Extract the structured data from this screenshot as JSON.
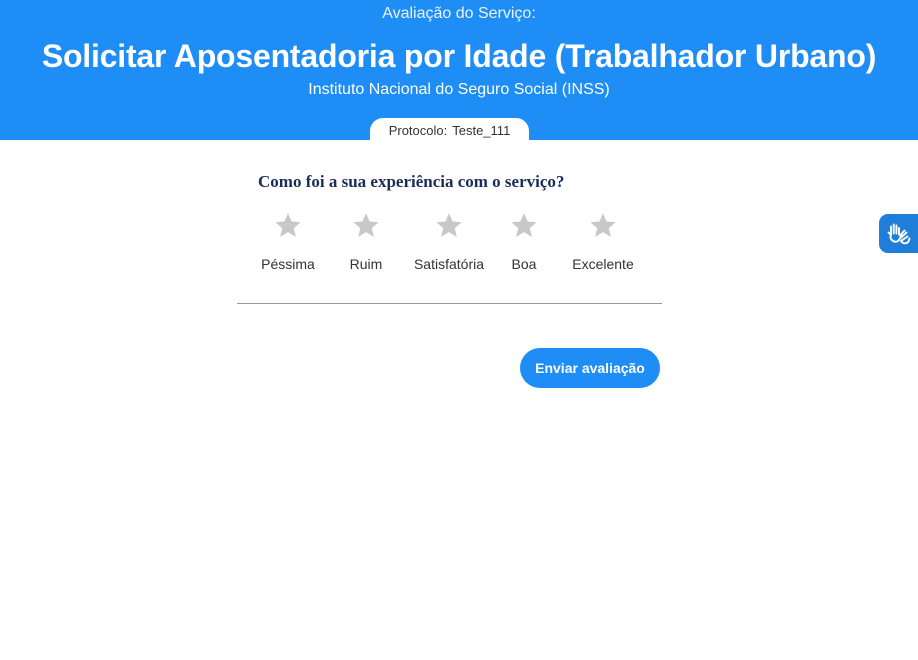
{
  "header": {
    "eyebrow": "Avaliação do Serviço:",
    "title": "Solicitar Aposentadoria por Idade (Trabalhador Urbano)",
    "subtitle": "Instituto Nacional do Seguro Social (INSS)",
    "protocol_label": "Protocolo:",
    "protocol_value": "Teste_111"
  },
  "survey": {
    "question": "Como foi a sua experiência com o serviço?",
    "options": [
      {
        "label": "Péssima",
        "icon": "star-icon"
      },
      {
        "label": "Ruim",
        "icon": "star-icon"
      },
      {
        "label": "Satisfatória",
        "icon": "star-icon"
      },
      {
        "label": "Boa",
        "icon": "star-icon"
      },
      {
        "label": "Excelente",
        "icon": "star-icon"
      }
    ],
    "submit_label": "Enviar avaliação"
  },
  "accessibility": {
    "icon": "sign-language-hands-icon"
  },
  "colors": {
    "header_bg": "#1e8df5",
    "star_inactive": "#c8c8c8",
    "question_text": "#1a2d5a",
    "button_bg": "#1e8df5",
    "accessibility_bg": "#1f7fd8"
  }
}
